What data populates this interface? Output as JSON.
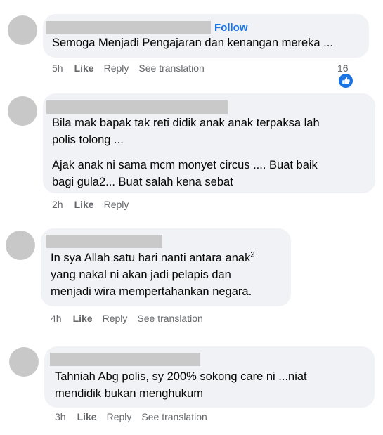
{
  "comments": [
    {
      "follow_label": "Follow",
      "lines": [
        "Semoga Menjadi Pengajaran dan kenangan mereka ..."
      ],
      "time": "5h",
      "like_label": "Like",
      "reply_label": "Reply",
      "translate_label": "See translation",
      "reaction_count": "16",
      "reaction_icon": "like-thumb-icon",
      "accent_color": "#1b74e4"
    },
    {
      "lines": [
        "Bila mak bapak tak reti didik anak anak terpaksa lah",
        "polis tolong ...",
        "Ajak anak ni sama mcm monyet circus .... Buat baik",
        "bagi gula2... Buat salah kena sebat"
      ],
      "time": "2h",
      "like_label": "Like",
      "reply_label": "Reply"
    },
    {
      "lines": [
        "In sya Allah satu hari nanti antara anak",
        "yang nakal ni akan jadi pelapis dan",
        "menjadi wira mempertahankan negara."
      ],
      "superscript": "2",
      "time": "4h",
      "like_label": "Like",
      "reply_label": "Reply",
      "translate_label": "See translation"
    },
    {
      "lines": [
        "Tahniah Abg polis, sy 200% sokong care ni ...niat",
        "mendidik bukan menghukum"
      ],
      "time": "3h",
      "like_label": "Like",
      "reply_label": "Reply",
      "translate_label": "See translation"
    }
  ]
}
